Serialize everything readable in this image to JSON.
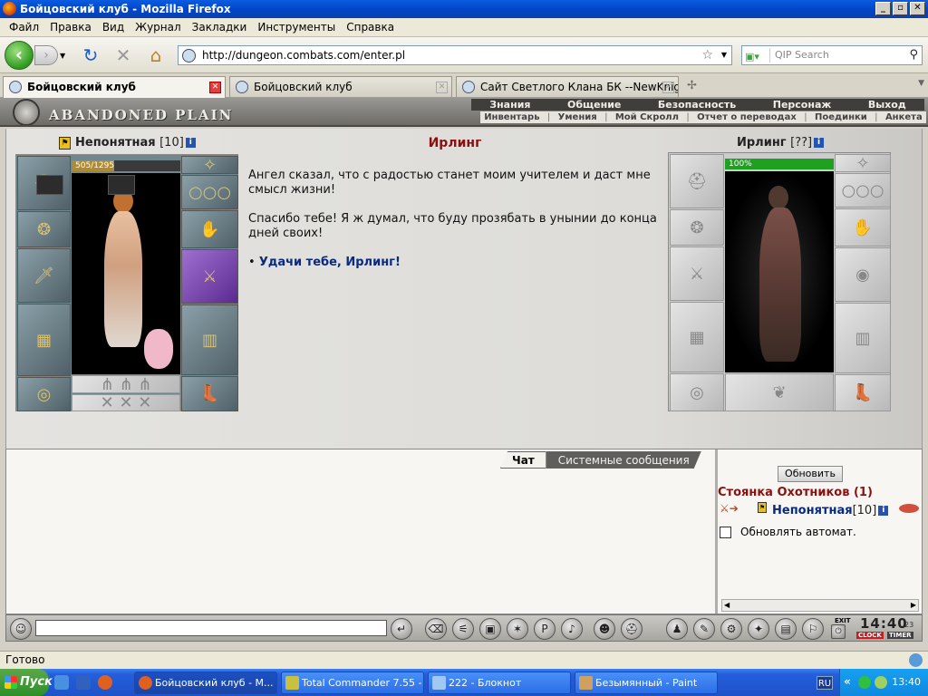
{
  "window": {
    "title": "Бойцовский клуб - Mozilla Firefox"
  },
  "menu": [
    "Файл",
    "Правка",
    "Вид",
    "Журнал",
    "Закладки",
    "Инструменты",
    "Справка"
  ],
  "nav": {
    "url": "http://dungeon.combats.com/enter.pl",
    "search_placeholder": "QIP Search"
  },
  "tabs": [
    {
      "label": "Бойцовский клуб",
      "active": true
    },
    {
      "label": "Бойцовский клуб",
      "active": false
    },
    {
      "label": "Сайт Светлого Клана БК --NewKnight...",
      "active": false
    }
  ],
  "game": {
    "location": "ABANDONED PLAIN",
    "main_nav": [
      "Знания",
      "Общение",
      "Безопасность",
      "Персонаж",
      "Выход"
    ],
    "sub_nav": [
      "Инвентарь",
      "Умения",
      "Мой Скролл",
      "Отчет о переводах",
      "Поединки",
      "Анкета"
    ]
  },
  "player": {
    "name": "Непонятная",
    "level": "[10]",
    "hp": "505/1295",
    "hp_fraction": 0.39
  },
  "npc": {
    "name": "Ирлинг",
    "level": "[??]",
    "hp": "100%",
    "hp_fraction": 1.0
  },
  "dialog": {
    "title": "Ирлинг",
    "text1": "Ангел сказал, что с радостью станет моим учителем и даст мне смысл жизни!",
    "text2": "Спасибо тебе! Я ж думал, что буду прозябать в унынии до конца дней своих!",
    "reply_bullet": "•",
    "reply": "Удачи тебе, Ирлинг!"
  },
  "chat": {
    "tab_chat": "Чат",
    "tab_system": "Системные сообщения"
  },
  "online": {
    "refresh": "Обновить",
    "room": "Стоянка Охотников (1)",
    "user_name": "Непонятная",
    "user_level": "[10]",
    "auto_refresh": "Обновлять автомат."
  },
  "clock": {
    "time": "14:40",
    "seconds": "23",
    "label_clock": "CLOCK",
    "label_timer": "TIMER",
    "exit": "EXIT"
  },
  "status": {
    "text": "Готово"
  },
  "taskbar": {
    "start": "Пуск",
    "tasks": [
      "Бойцовский клуб - М...",
      "Total Commander 7.55 - ...",
      "222 - Блокнот",
      "Безымянный - Paint"
    ],
    "lang": "RU",
    "time": "13:40"
  },
  "colors": {
    "accent_red": "#8b1010",
    "link_blue": "#0a2a80",
    "hp_player": "#b08a30",
    "hp_npc": "#20a020"
  }
}
